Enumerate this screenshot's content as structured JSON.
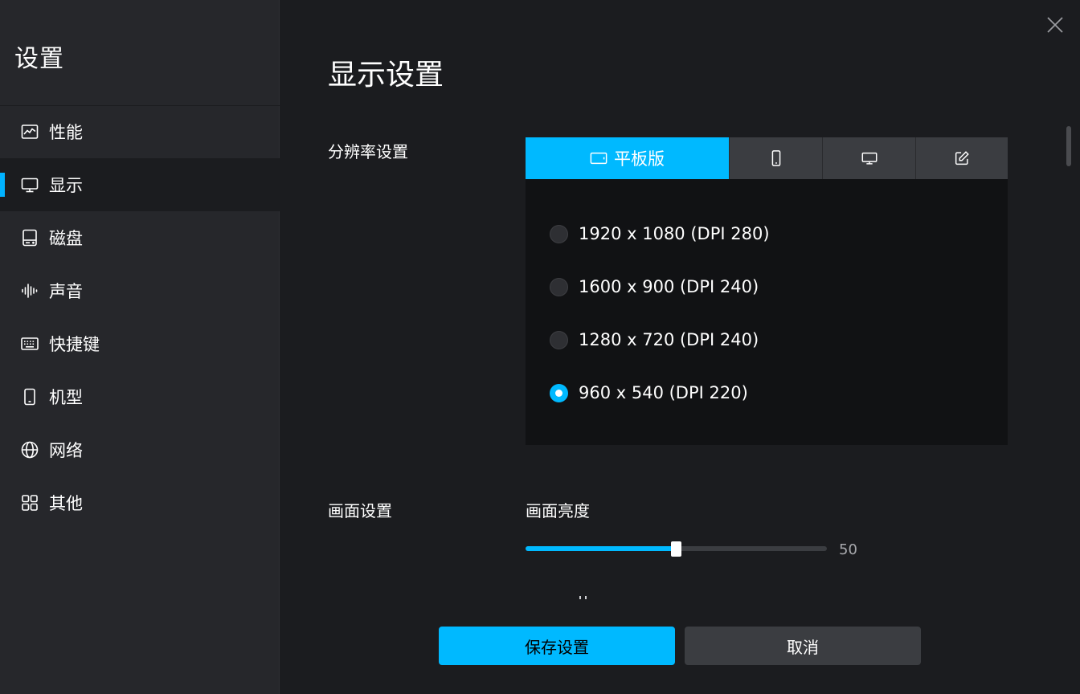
{
  "sidebar": {
    "title": "设置",
    "items": [
      {
        "label": "性能",
        "icon": "chart-icon"
      },
      {
        "label": "显示",
        "icon": "monitor-icon"
      },
      {
        "label": "磁盘",
        "icon": "disk-icon"
      },
      {
        "label": "声音",
        "icon": "sound-wave-icon"
      },
      {
        "label": "快捷键",
        "icon": "keyboard-icon"
      },
      {
        "label": "机型",
        "icon": "phone-icon"
      },
      {
        "label": "网络",
        "icon": "globe-icon"
      },
      {
        "label": "其他",
        "icon": "grid-icon"
      }
    ],
    "active_index": 1
  },
  "main": {
    "title": "显示设置",
    "resolution": {
      "label": "分辨率设置",
      "tabs": [
        {
          "label": "平板版",
          "icon": "tablet-icon"
        },
        {
          "label": "",
          "icon": "phone-icon"
        },
        {
          "label": "",
          "icon": "monitor-icon"
        },
        {
          "label": "",
          "icon": "edit-icon"
        }
      ],
      "active_tab": 0,
      "options": [
        "1920 x 1080 (DPI 280)",
        "1600 x 900 (DPI 240)",
        "1280 x 720 (DPI 240)",
        "960 x 540 (DPI 220)"
      ],
      "selected_option": 3
    },
    "picture": {
      "label": "画面设置",
      "brightness_label": "画面亮度",
      "brightness_value": "50",
      "brightness_fraction": 0.5
    }
  },
  "footer": {
    "save_label": "保存设置",
    "cancel_label": "取消"
  },
  "colors": {
    "accent": "#00b9ff",
    "background": "#1b1c1f",
    "sidebar": "#26272b",
    "panel": "#111214"
  }
}
